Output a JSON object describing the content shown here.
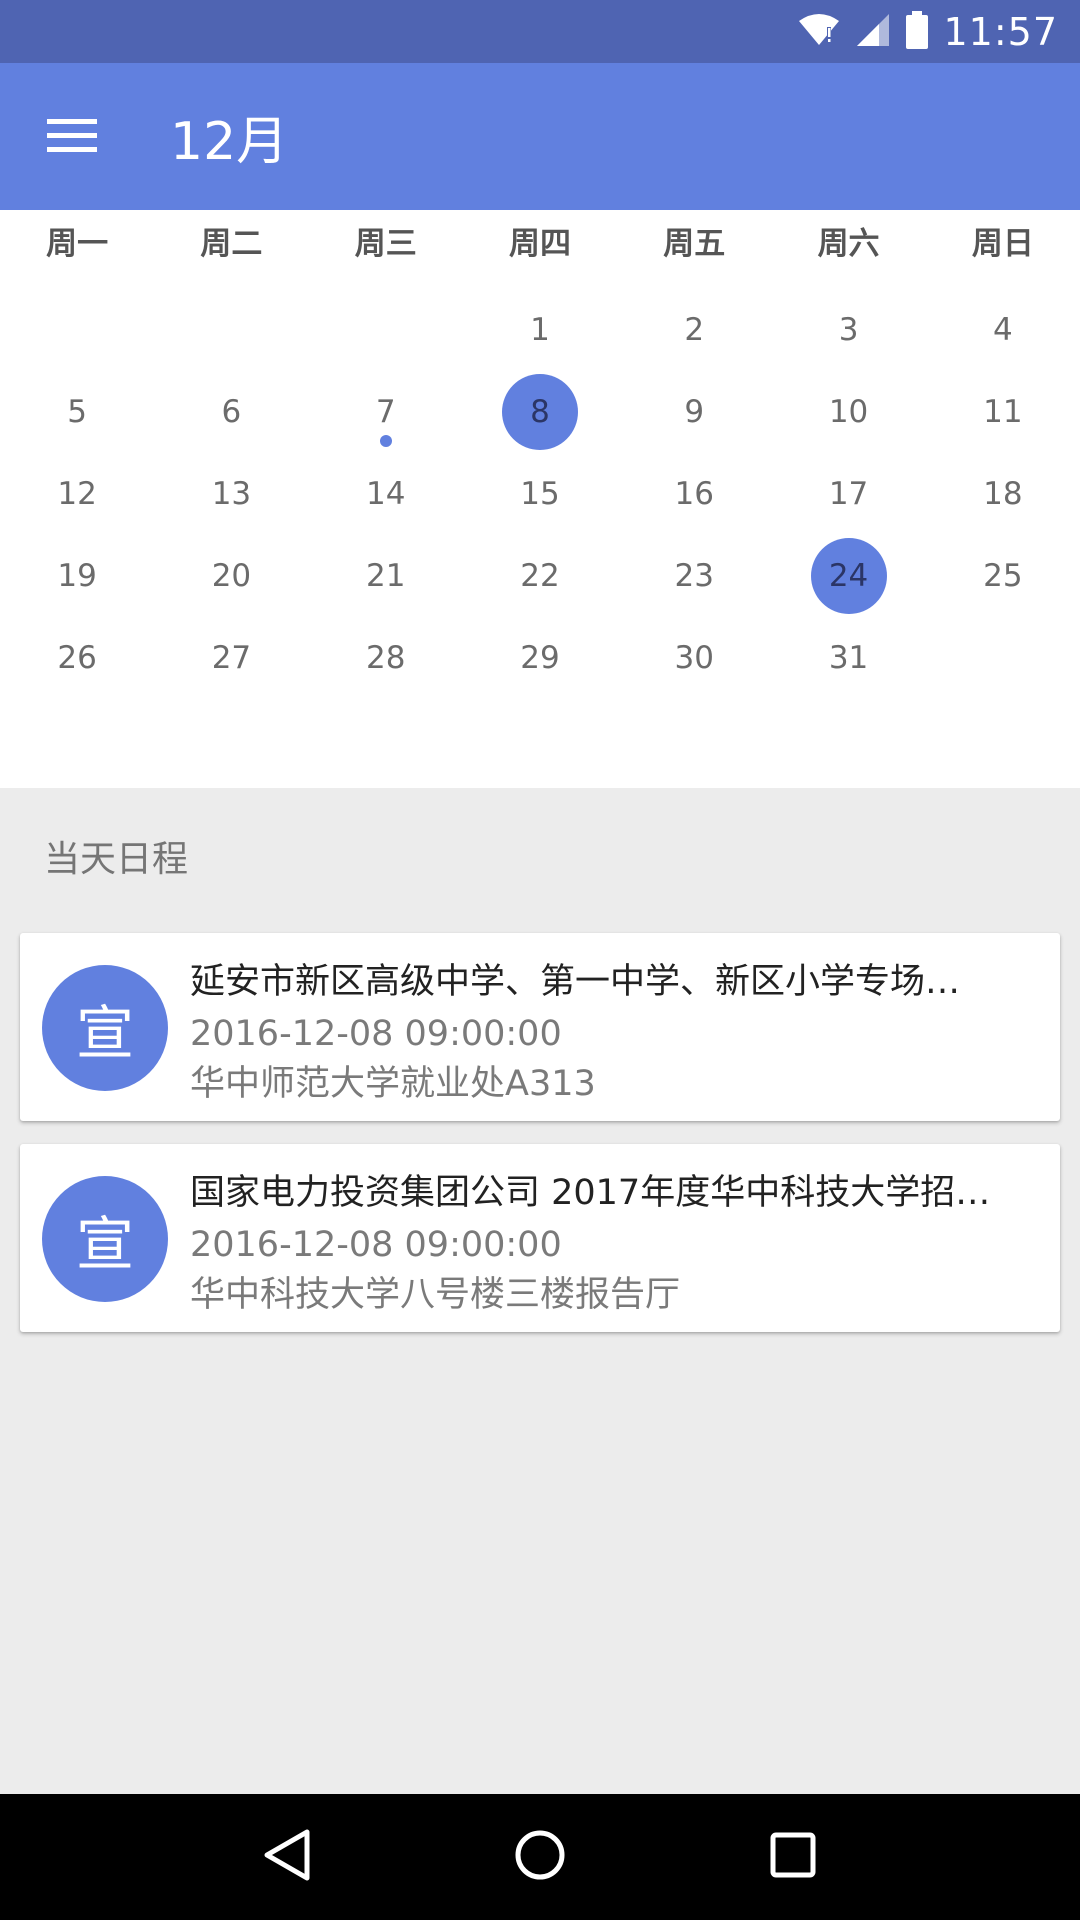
{
  "status_bar": {
    "time": "11:57",
    "colors": {
      "background": "#4f64b2"
    }
  },
  "app_bar": {
    "title": "12月",
    "colors": {
      "background": "#6180df"
    }
  },
  "calendar": {
    "weekdays": [
      "周一",
      "周二",
      "周三",
      "周四",
      "周五",
      "周六",
      "周日"
    ],
    "weeks": [
      [
        "",
        "",
        "",
        "1",
        "2",
        "3",
        "4"
      ],
      [
        "5",
        "6",
        "7",
        "8",
        "9",
        "10",
        "11"
      ],
      [
        "12",
        "13",
        "14",
        "15",
        "16",
        "17",
        "18"
      ],
      [
        "19",
        "20",
        "21",
        "22",
        "23",
        "24",
        "25"
      ],
      [
        "26",
        "27",
        "28",
        "29",
        "30",
        "31",
        ""
      ]
    ],
    "selected_days": [
      "8",
      "24"
    ],
    "event_dot_days": [
      "7"
    ],
    "accent_color": "#6180df"
  },
  "schedule": {
    "section_label": "当天日程",
    "events": [
      {
        "avatar_text": "宣",
        "title": "延安市新区高级中学、第一中学、新区小学专场…",
        "datetime": "2016-12-08 09:00:00",
        "location": "华中师范大学就业处A313"
      },
      {
        "avatar_text": "宣",
        "title": "国家电力投资集团公司 2017年度华中科技大学招…",
        "datetime": "2016-12-08 09:00:00",
        "location": "华中科技大学八号楼三楼报告厅"
      }
    ]
  },
  "nav_bar": {
    "icons": [
      "back-icon",
      "home-icon",
      "recents-icon"
    ]
  }
}
